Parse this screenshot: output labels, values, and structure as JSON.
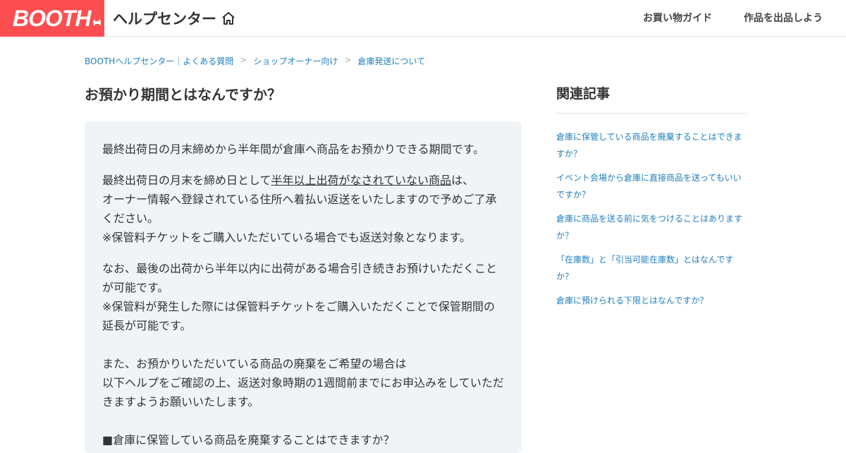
{
  "header": {
    "logo_text": "BOOTH",
    "brand_color": "#fc4d50",
    "help_center_title": "ヘルプセンター",
    "home_icon": "home-icon",
    "nav": [
      {
        "label": "お買い物ガイド"
      },
      {
        "label": "作品を出品しよう"
      }
    ]
  },
  "breadcrumb": [
    {
      "label": "BOOTHヘルプセンター｜よくある質問"
    },
    {
      "label": "ショップオーナー向け"
    },
    {
      "label": "倉庫発送について"
    }
  ],
  "breadcrumb_separator": ">",
  "article": {
    "title": "お預かり期間とはなんですか？",
    "p1": "最終出荷日の月末締めから半年間が倉庫へ商品をお預かりできる期間です。",
    "p2_line1_before": "最終出荷日の月末を締め日として",
    "p2_line1_underline": "半年以上出荷がなされていない商品",
    "p2_line1_after": "は、",
    "p2_line2": "オーナー情報へ登録されている住所へ着払い返送をいたしますので予めご了承ください。",
    "p2_line3": "※保管料チケットをご購入いただいている場合でも返送対象となります。",
    "p3_line1": "なお、最後の出荷から半年以内に出荷がある場合引き続きお預けいただくことが可能です。",
    "p3_line2": "※保管料が発生した際には保管料チケットをご購入いただくことで保管期間の延長が可能です。",
    "p3_line3": "また、お預かりいただいている商品の廃棄をご希望の場合は",
    "p3_line4": "以下ヘルプをご確認の上、返送対象時期の1週間前までにお申込みをしていただきますようお願いいたします。",
    "p3_line5": "■倉庫に保管している商品を廃棄することはできますか？"
  },
  "related": {
    "heading": "関連記事",
    "items": [
      {
        "label": "倉庫に保管している商品を廃棄することはできますか？"
      },
      {
        "label": "イベント会場から倉庫に直接商品を送ってもいいですか？"
      },
      {
        "label": "倉庫に商品を送る前に気をつけることはありますか？"
      },
      {
        "label": "「在庫数」と「引当可能在庫数」とはなんですか？"
      },
      {
        "label": "倉庫に預けられる下限とはなんですか？"
      }
    ]
  },
  "colors": {
    "link": "#1f7fbe",
    "content_background": "#f1f4f7"
  }
}
